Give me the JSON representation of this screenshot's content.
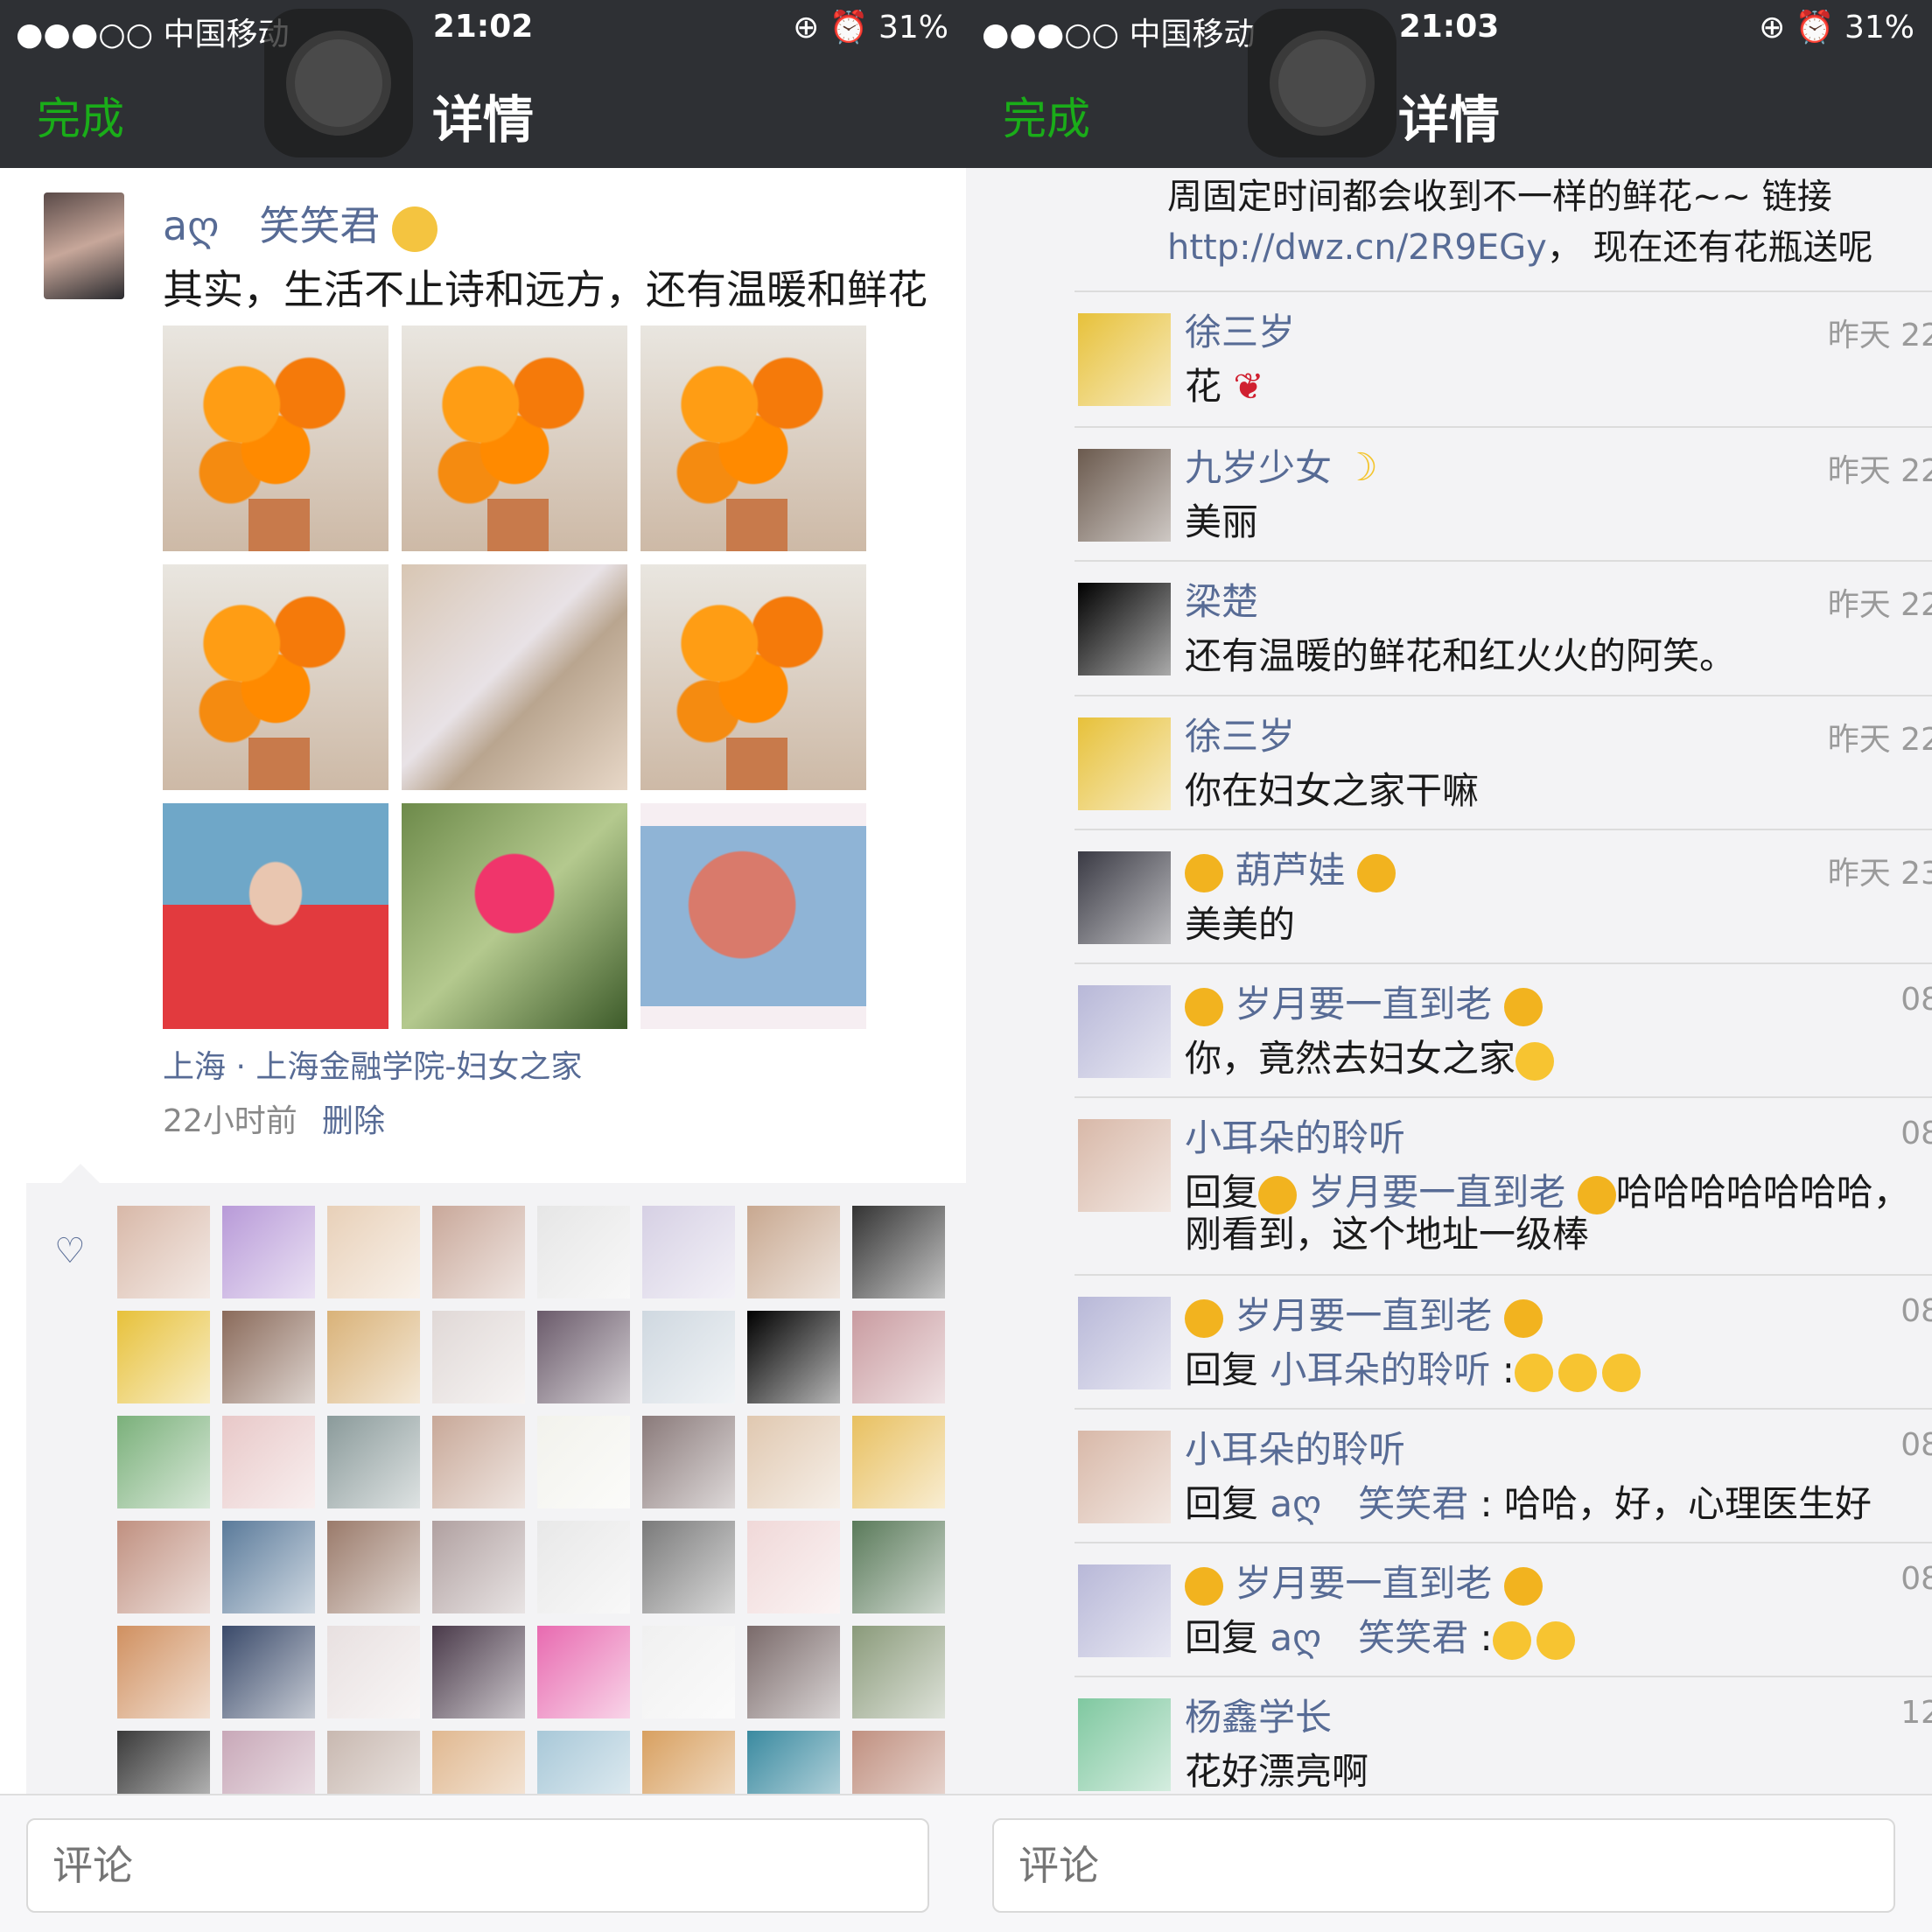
{
  "status_bar": {
    "left": {
      "carrier": "●●●○○ 中国移动",
      "time": "21:02",
      "right": "31%"
    },
    "right": {
      "carrier": "●●●○○ 中国移动",
      "time": "21:03",
      "right": "31%"
    }
  },
  "nav": {
    "done_label": "完成",
    "title": "详情"
  },
  "post": {
    "author": "aღ　笑笑君",
    "text": "其实，生活不止诗和远方，还有温暖和鲜花",
    "location": "上海 · 上海金融学院-妇女之家",
    "time": "22小时前",
    "delete_label": "删除",
    "photos": [
      "flower",
      "flower",
      "flower",
      "flower",
      "giftbox",
      "flower",
      "girl",
      "pink",
      "tree"
    ]
  },
  "likes": {
    "icon": "heart-outline-icon",
    "avatar_colors": [
      "#d8b8a8",
      "#b89ad8",
      "#e8d0b8",
      "#c9a89a",
      "#e6e6e6",
      "#d6d0e4",
      "#c8a890",
      "#333333",
      "#e7c13a",
      "#8a6a5a",
      "#d9b278",
      "#e0d8d6",
      "#6a5a6a",
      "#cfd8e0",
      "#000000",
      "#c99ba0",
      "#7ab07a",
      "#e8c8c8",
      "#8a9a9a",
      "#c8a898",
      "#f2f2ec",
      "#8a7a7a",
      "#e0c8b0",
      "#e8c060",
      "#c09080",
      "#5a7a9a",
      "#9a7a6a",
      "#b0a0a0",
      "#e8e8e8",
      "#7a7a7a",
      "#f0d8d8",
      "#5a7a5a",
      "#d09060",
      "#3a4a6a",
      "#e8e0e0",
      "#4a3a4a",
      "#e86ab0",
      "#f0f0f0",
      "#7a6a6a",
      "#8a9a7a",
      "#3a3a3a",
      "#c8a8b8",
      "#c8b8b0",
      "#e0b890",
      "#a8c8d8",
      "#d8a060",
      "#3a8aa0",
      "#c09080"
    ]
  },
  "comment_bar": {
    "placeholder": "评论"
  },
  "prev_comment": {
    "line1": "周固定时间都会收到不一样的鲜花~~ 链接",
    "url": "http://dwz.cn/2R9EGy",
    "line2_tail": "，  现在还有花瓶送呢"
  },
  "comments": [
    {
      "name": "徐三岁",
      "time": "昨天 22",
      "text": "花",
      "avatar": "#e7c13a"
    },
    {
      "name": "九岁少女",
      "time": "昨天 22",
      "text": "美丽",
      "avatar": "#6b5a4e"
    },
    {
      "name": "梁楚",
      "time": "昨天 22",
      "text": "还有温暖的鲜花和红火火的阿笑。",
      "avatar": "#000000"
    },
    {
      "name": "徐三岁",
      "time": "昨天 22",
      "text": "你在妇女之家干嘛",
      "avatar": "#e7c13a"
    },
    {
      "name": "葫芦娃",
      "time": "昨天 23",
      "text": "美美的",
      "avatar": "#3a3a44"
    },
    {
      "name": "岁月要一直到老",
      "time": "08",
      "text": "你，竟然去妇女之家",
      "avatar": "#b8b8d8"
    },
    {
      "name": "小耳朵的聆听",
      "time": "08",
      "text_prefix": "回复",
      "reply_to": "岁月要一直到老",
      "text": "哈哈哈哈哈哈哈，",
      "text2": "刚看到，这个地址一级棒",
      "avatar": "#d8b8a8"
    },
    {
      "name": "岁月要一直到老",
      "time": "08",
      "text_prefix": "回复",
      "reply_to": "小耳朵的聆听",
      "text": ":",
      "avatar": "#b8b8d8"
    },
    {
      "name": "小耳朵的聆听",
      "time": "08",
      "text_prefix": "回复",
      "reply_to": "aღ　笑笑君",
      "text": ": 哈哈，好，心理医生好",
      "avatar": "#d8b8a8"
    },
    {
      "name": "岁月要一直到老",
      "time": "08",
      "text_prefix": "回复",
      "reply_to": "aღ　笑笑君",
      "text": ":",
      "avatar": "#b8b8d8"
    },
    {
      "name": "杨鑫学长",
      "time": "12",
      "text": "花好漂亮啊",
      "avatar": "#7fc8a0"
    }
  ]
}
